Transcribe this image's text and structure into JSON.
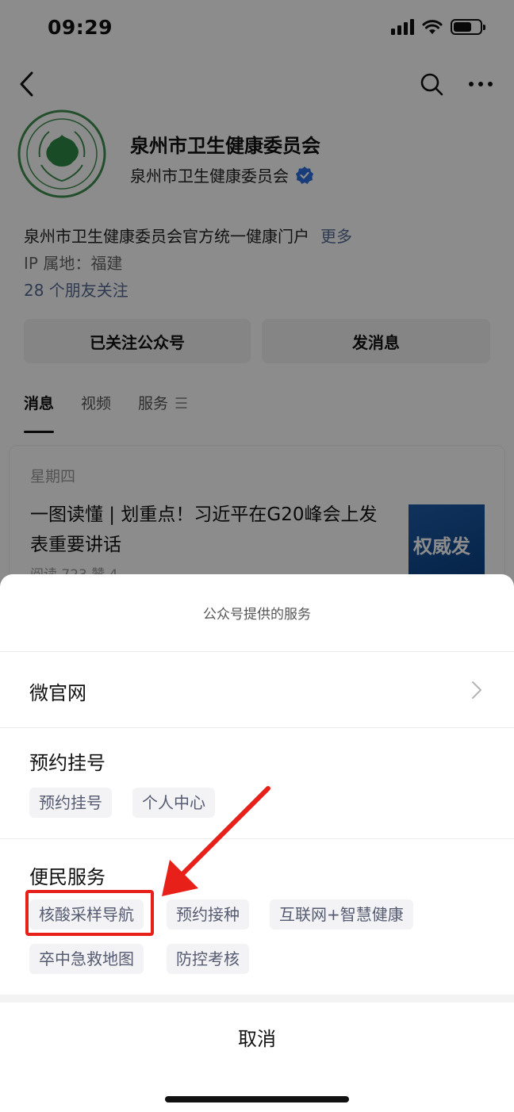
{
  "status_bar": {
    "time": "09:29"
  },
  "profile": {
    "name": "泉州市卫生健康委员会",
    "subject": "泉州市卫生健康委员会",
    "logo_text": "QUANZHOU HEALTH COMMITTEE",
    "description": "泉州市卫生健康委员会官方统一健康门户",
    "more_label": "更多",
    "ip_location": "IP 属地：福建",
    "friends_following": "28 个朋友关注"
  },
  "actions": {
    "follow_label": "已关注公众号",
    "message_label": "发消息"
  },
  "tabs": [
    {
      "label": "消息",
      "active": true
    },
    {
      "label": "视频",
      "active": false
    },
    {
      "label": "服务",
      "active": false
    }
  ],
  "article": {
    "day": "星期四",
    "title": "一图读懂 | 划重点！习近平在G20峰会上发表重要讲话",
    "meta": "阅读 723  赞 4",
    "thumb_text": "权威发"
  },
  "sheet": {
    "header": "公众号提供的服务",
    "link_label": "微官网",
    "groups": [
      {
        "title": "预约挂号",
        "items": [
          "预约挂号",
          "个人中心"
        ]
      },
      {
        "title": "便民服务",
        "items": [
          "核酸采样导航",
          "预约接种",
          "互联网+智慧健康",
          "卒中急救地图",
          "防控考核"
        ]
      }
    ],
    "cancel_label": "取消"
  },
  "colors": {
    "accent_link": "#576b95",
    "highlight": "#e8201a",
    "verified": "#2f6fde"
  }
}
